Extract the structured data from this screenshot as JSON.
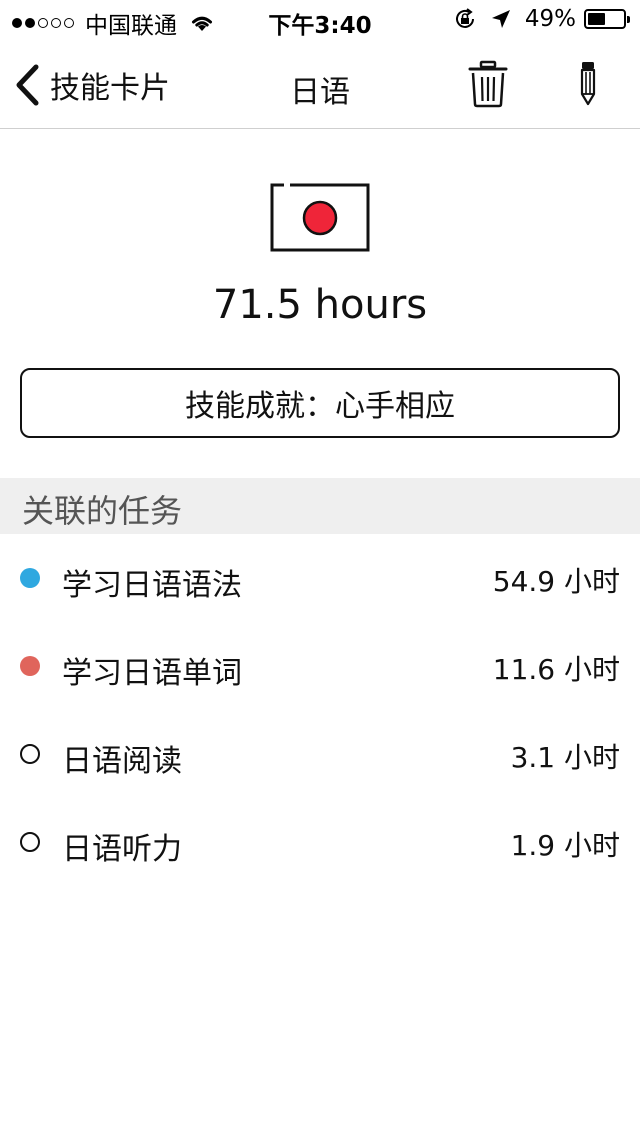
{
  "status_bar": {
    "carrier": "中国联通",
    "time": "下午3:40",
    "battery_percent": "49%",
    "battery_level": 0.49,
    "signal_strength": 2,
    "signal_max": 5,
    "icons": [
      "wifi-icon",
      "rotation-lock-icon",
      "location-icon",
      "battery-icon"
    ]
  },
  "nav": {
    "back_label": "技能卡片",
    "title": "日语",
    "icons": [
      "chevron-left-icon",
      "trash-icon",
      "pencil-icon"
    ]
  },
  "skill": {
    "icon": "japan-flag-icon",
    "hours": "71.5 hours",
    "achievement": "技能成就：心手相应",
    "flag_color": "#ef2539"
  },
  "section": {
    "title": "关联的任务"
  },
  "tasks": [
    {
      "name": "学习日语语法",
      "hours": "54.9 小时",
      "dot_color": "#2fa8e0",
      "filled": true
    },
    {
      "name": "学习日语单词",
      "hours": "11.6 小时",
      "dot_color": "#e0655c",
      "filled": true
    },
    {
      "name": "日语阅读",
      "hours": "3.1 小时",
      "dot_color": "#111111",
      "filled": false
    },
    {
      "name": "日语听力",
      "hours": "1.9 小时",
      "dot_color": "#111111",
      "filled": false
    }
  ]
}
